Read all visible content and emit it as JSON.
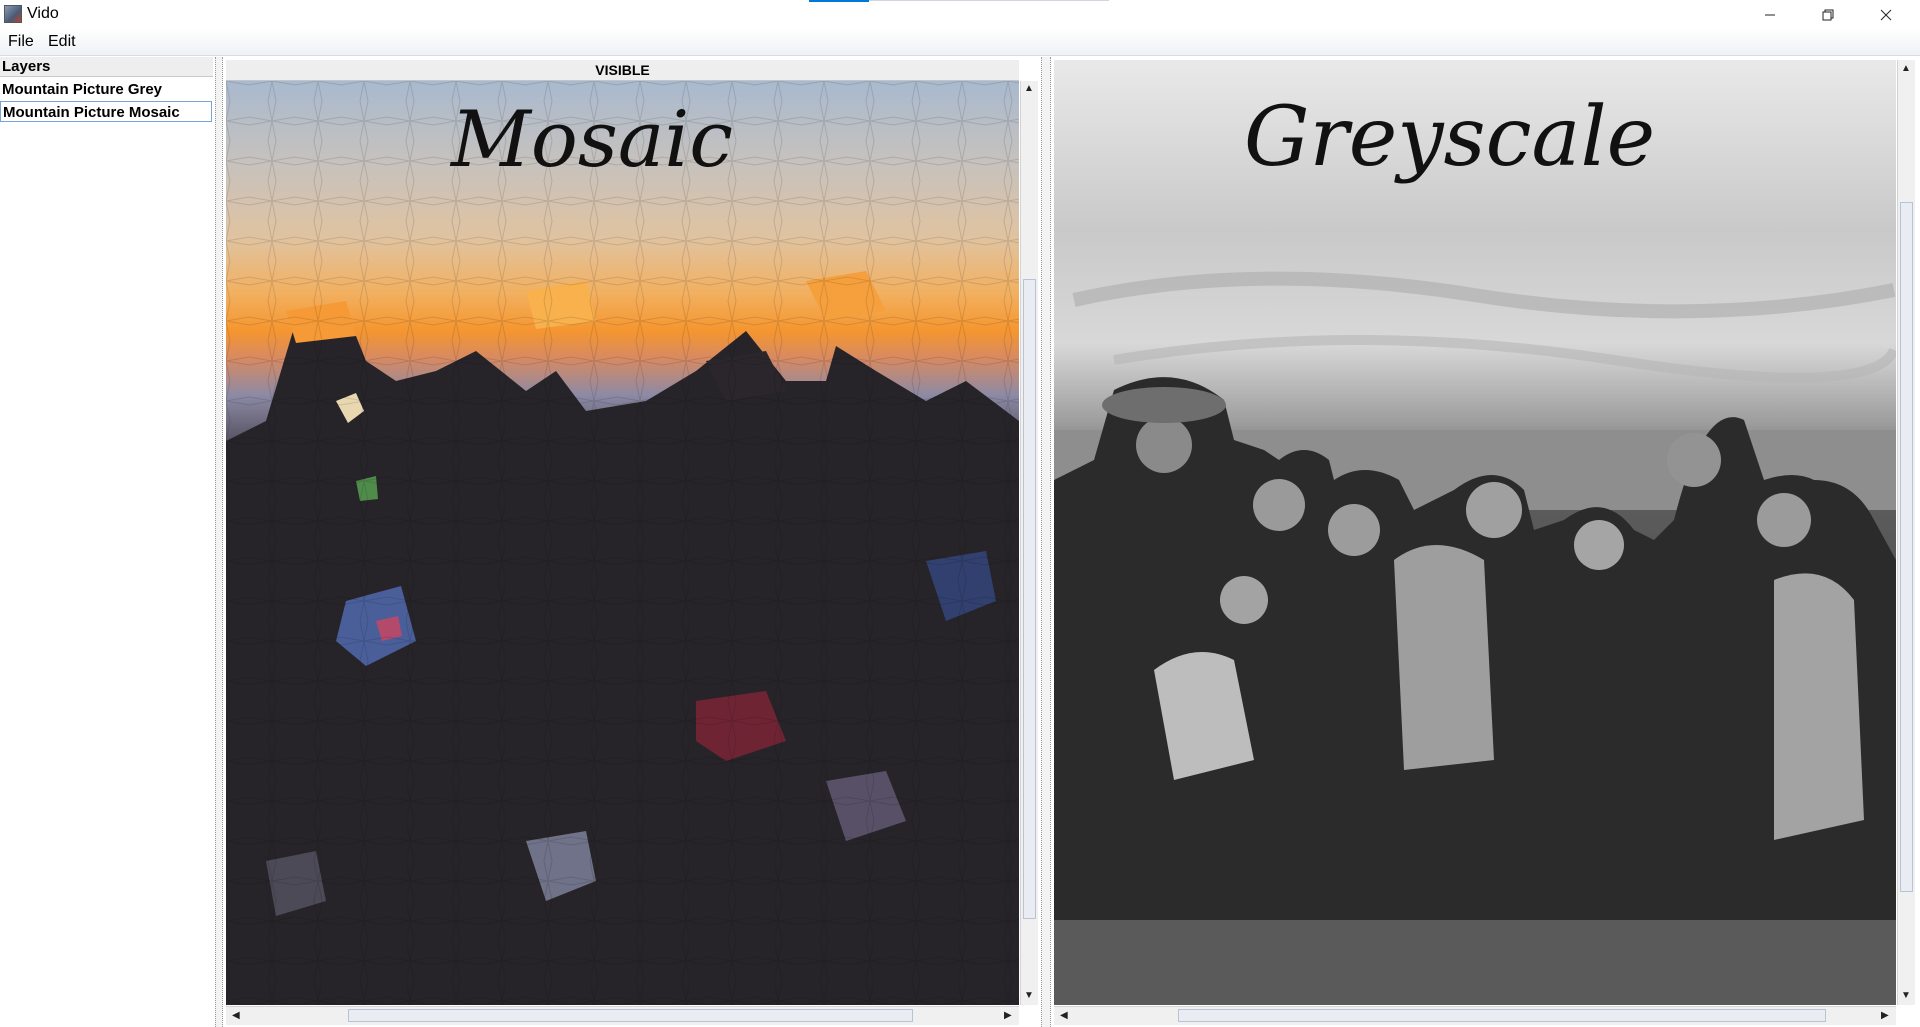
{
  "window": {
    "title": "Vido"
  },
  "menu": {
    "file": "File",
    "edit": "Edit"
  },
  "layers": {
    "header": "Layers",
    "items": [
      {
        "label": "Mountain Picture Grey",
        "selected": false
      },
      {
        "label": "Mountain Picture Mosaic",
        "selected": true
      }
    ]
  },
  "visible_panel": {
    "header": "VISIBLE"
  },
  "left_image": {
    "caption": "Mosaic"
  },
  "right_image": {
    "caption": "Greyscale"
  },
  "icons": [
    "app-icon",
    "minimize-icon",
    "restore-icon",
    "close-icon",
    "arrow-up-icon",
    "arrow-down-icon",
    "arrow-left-icon",
    "arrow-right-icon"
  ]
}
